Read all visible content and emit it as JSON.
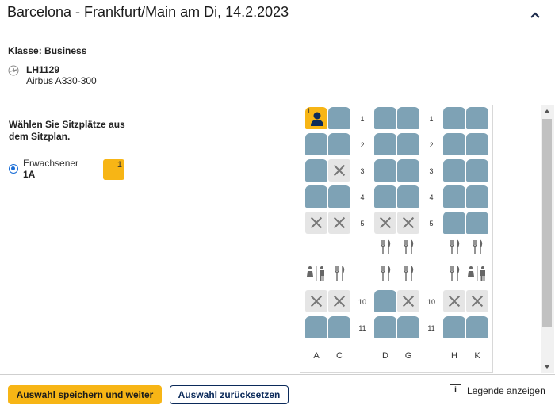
{
  "header": {
    "title": "Barcelona - Frankfurt/Main am Di, 14.2.2023"
  },
  "flight": {
    "class_label": "Klasse: Business",
    "number": "LH1129",
    "aircraft": "Airbus A330-300"
  },
  "passenger_panel": {
    "instruction": "Wählen Sie Sitzplätze aus dem Sitzplan.",
    "passenger_type": "Erwachsener",
    "passenger_seat": "1A",
    "passenger_index": "1"
  },
  "seatmap": {
    "columns": [
      "A",
      "C",
      "D",
      "G",
      "H",
      "K"
    ],
    "selected_marker": "1",
    "rows": [
      {
        "row": "1",
        "A": "selected",
        "C": "available",
        "D": "available",
        "G": "available",
        "H": "available",
        "K": "available"
      },
      {
        "row": "2",
        "A": "available",
        "C": "available",
        "D": "available",
        "G": "available",
        "H": "available",
        "K": "available"
      },
      {
        "row": "3",
        "A": "available",
        "C": "occupied",
        "D": "available",
        "G": "available",
        "H": "available",
        "K": "available"
      },
      {
        "row": "4",
        "A": "available",
        "C": "available",
        "D": "available",
        "G": "available",
        "H": "available",
        "K": "available"
      },
      {
        "row": "5",
        "A": "occupied",
        "C": "occupied",
        "D": "occupied",
        "G": "occupied",
        "H": "available",
        "K": "available"
      },
      {
        "row": "10",
        "A": "occupied",
        "C": "occupied",
        "D": "available",
        "G": "occupied",
        "H": "occupied",
        "K": "occupied"
      },
      {
        "row": "11",
        "A": "available",
        "C": "available",
        "D": "available",
        "G": "available",
        "H": "available",
        "K": "available"
      }
    ]
  },
  "footer": {
    "save_label": "Auswahl speichern und weiter",
    "reset_label": "Auswahl zurücksetzen",
    "legend_icon": "i",
    "legend_label": "Legende anzeigen"
  },
  "colors": {
    "accent": "#f7b515",
    "seat_available": "#7ea2b5",
    "seat_occupied": "#e5e5e5",
    "navy": "#0b2a5a"
  }
}
